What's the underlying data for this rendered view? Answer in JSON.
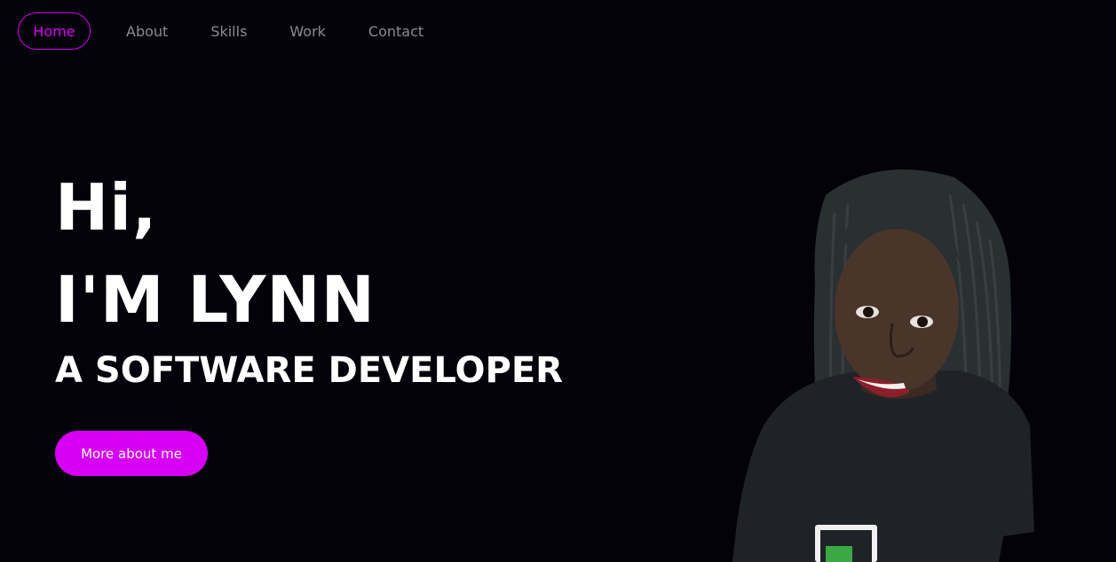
{
  "nav": {
    "items": [
      {
        "label": "Home",
        "active": true
      },
      {
        "label": "About",
        "active": false
      },
      {
        "label": "Skills",
        "active": false
      },
      {
        "label": "Work",
        "active": false
      },
      {
        "label": "Contact",
        "active": false
      }
    ]
  },
  "hero": {
    "greeting": "Hi,",
    "name": "I'M LYNN",
    "role": "A SOFTWARE DEVELOPER",
    "cta_label": "More about me"
  },
  "colors": {
    "background": "#03020a",
    "accent": "#d600f5",
    "nav_text": "#8c8a93",
    "heading": "#ffffff"
  },
  "portrait": {
    "icon": "portrait-photo"
  }
}
